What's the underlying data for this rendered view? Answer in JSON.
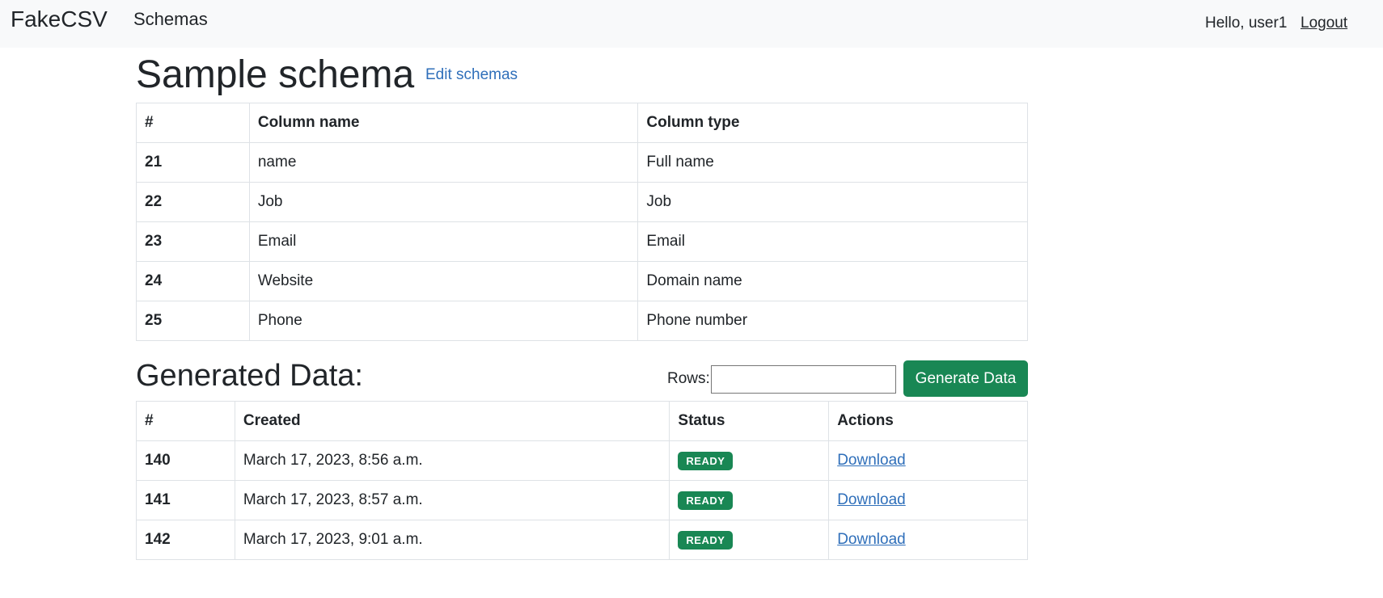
{
  "navbar": {
    "brand": "FakeCSV",
    "nav_schemas": "Schemas",
    "greeting": "Hello, user1",
    "logout": "Logout"
  },
  "schema": {
    "title": "Sample schema",
    "edit_link": "Edit schemas",
    "columns": [
      "#",
      "Column name",
      "Column type"
    ],
    "rows": [
      {
        "id": "21",
        "name": "name",
        "type": "Full name"
      },
      {
        "id": "22",
        "name": "Job",
        "type": "Job"
      },
      {
        "id": "23",
        "name": "Email",
        "type": "Email"
      },
      {
        "id": "24",
        "name": "Website",
        "type": "Domain name"
      },
      {
        "id": "25",
        "name": "Phone",
        "type": "Phone number"
      }
    ]
  },
  "generated": {
    "title": "Generated Data:",
    "rows_label": "Rows:",
    "rows_value": "",
    "generate_button": "Generate Data",
    "columns": [
      "#",
      "Created",
      "Status",
      "Actions"
    ],
    "rows": [
      {
        "id": "140",
        "created": "March 17, 2023, 8:56 a.m.",
        "status": "READY",
        "action": "Download"
      },
      {
        "id": "141",
        "created": "March 17, 2023, 8:57 a.m.",
        "status": "READY",
        "action": "Download"
      },
      {
        "id": "142",
        "created": "March 17, 2023, 9:01 a.m.",
        "status": "READY",
        "action": "Download"
      }
    ]
  },
  "colors": {
    "success": "#198754",
    "link": "#2f6fba",
    "navbar_bg": "#f8f9fa"
  }
}
